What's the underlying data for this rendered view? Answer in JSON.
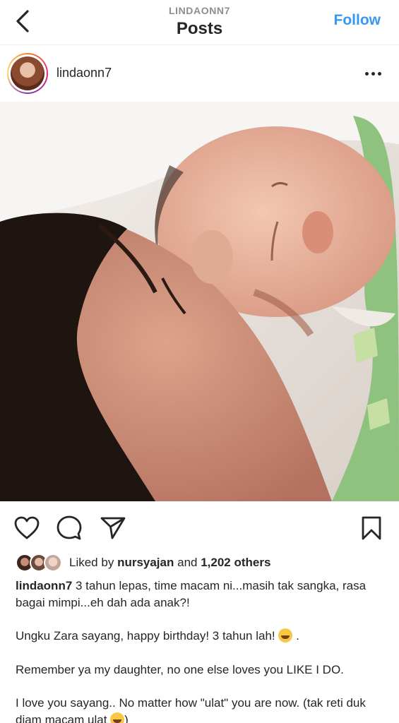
{
  "header": {
    "username_upper": "LINDAONN7",
    "title": "Posts",
    "follow_label": "Follow"
  },
  "post": {
    "author": "lindaonn7",
    "likes": {
      "prefix": "Liked by",
      "liker": "nursyajan",
      "middle": "and",
      "others": "1,202 others"
    },
    "caption": {
      "user": "lindaonn7",
      "line1": " 3 tahun lepas, time macam ni...masih tak sangka, rasa bagai mimpi...eh dah ada anak?!",
      "line2_before": "Ungku Zara sayang, happy birthday! 3 tahun lah! ",
      "line2_after": " .",
      "line3": "Remember ya my daughter, no one else loves you LIKE I DO.",
      "line4_before": "I love you sayang.. No matter how \"ulat\" you are now. (tak reti duk diam macam ulat ",
      "line4_after": ")"
    }
  },
  "icons": {
    "back": "chevron-left-icon",
    "more": "more-horizontal-icon",
    "like": "heart-icon",
    "comment": "comment-icon",
    "share": "send-icon",
    "save": "bookmark-icon",
    "emoji": "grinning-face-emoji"
  },
  "colors": {
    "follow": "#3897f0",
    "text": "#262626",
    "secondary": "#8e8e8e"
  }
}
